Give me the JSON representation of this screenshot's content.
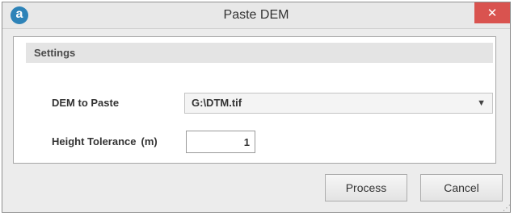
{
  "window": {
    "title": "Paste DEM",
    "app_icon_glyph": "a",
    "app_icon": "app-logo-icon",
    "close_glyph": "✕",
    "close_icon": "close-icon"
  },
  "settings": {
    "header": "Settings",
    "dem_label": "DEM to Paste",
    "dem_value": "G:\\DTM.tif",
    "dropdown_icon": "chevron-down-icon",
    "height_label": "Height Tolerance",
    "height_unit": "(m)",
    "height_value": "1"
  },
  "buttons": {
    "process": "Process",
    "cancel": "Cancel"
  },
  "colors": {
    "close_button": "#d9534f",
    "app_logo": "#2e83b8",
    "window_background": "#ececec"
  }
}
